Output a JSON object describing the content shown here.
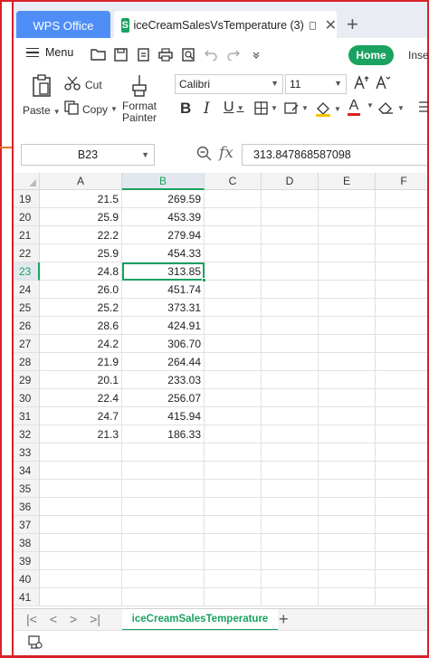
{
  "tabs": {
    "app_tab": "WPS Office",
    "doc_tab": "iceCreamSalesVsTemperature (3)",
    "doc_icon": "S"
  },
  "toolbar": {
    "menu_label": "Menu",
    "home_label": "Home",
    "insert_label": "Inse",
    "paste_label": "Paste",
    "cut_label": "Cut",
    "copy_label": "Copy",
    "format_painter_line1": "Format",
    "format_painter_line2": "Painter",
    "font_name": "Calibri",
    "font_size": "11",
    "bold_glyph": "B",
    "italic_glyph": "I",
    "underline_glyph": "U",
    "font_color_glyph": "A",
    "accent_color": "#1aa260"
  },
  "formula_bar": {
    "name_box": "B23",
    "fx_label": "fx",
    "formula_value": "313.847868587098"
  },
  "grid": {
    "columns": [
      "A",
      "B",
      "C",
      "D",
      "E",
      "F"
    ],
    "active_column": "B",
    "active_row": "23",
    "rows": [
      {
        "num": "19",
        "a": "21.5",
        "b": "269.59"
      },
      {
        "num": "20",
        "a": "25.9",
        "b": "453.39"
      },
      {
        "num": "21",
        "a": "22.2",
        "b": "279.94"
      },
      {
        "num": "22",
        "a": "25.9",
        "b": "454.33"
      },
      {
        "num": "23",
        "a": "24.8",
        "b": "313.85"
      },
      {
        "num": "24",
        "a": "26.0",
        "b": "451.74"
      },
      {
        "num": "25",
        "a": "25.2",
        "b": "373.31"
      },
      {
        "num": "26",
        "a": "28.6",
        "b": "424.91"
      },
      {
        "num": "27",
        "a": "24.2",
        "b": "306.70"
      },
      {
        "num": "28",
        "a": "21.9",
        "b": "264.44"
      },
      {
        "num": "29",
        "a": "20.1",
        "b": "233.03"
      },
      {
        "num": "30",
        "a": "22.4",
        "b": "256.07"
      },
      {
        "num": "31",
        "a": "24.7",
        "b": "415.94"
      },
      {
        "num": "32",
        "a": "21.3",
        "b": "186.33"
      },
      {
        "num": "33",
        "a": "",
        "b": ""
      },
      {
        "num": "34",
        "a": "",
        "b": ""
      },
      {
        "num": "35",
        "a": "",
        "b": ""
      },
      {
        "num": "36",
        "a": "",
        "b": ""
      },
      {
        "num": "37",
        "a": "",
        "b": ""
      },
      {
        "num": "38",
        "a": "",
        "b": ""
      },
      {
        "num": "39",
        "a": "",
        "b": ""
      },
      {
        "num": "40",
        "a": "",
        "b": ""
      },
      {
        "num": "41",
        "a": "",
        "b": ""
      }
    ]
  },
  "sheets": {
    "active_sheet": "iceCreamSalesTemperature"
  }
}
